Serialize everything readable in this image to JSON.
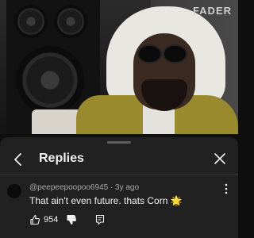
{
  "video": {
    "brand": "FADER"
  },
  "panel": {
    "title": "Replies"
  },
  "comment": {
    "author": "@peepeepoopoo6945",
    "separator": " · ",
    "age": "3y ago",
    "text": "That ain't even future. thats Corn 🌟",
    "likes": "954"
  },
  "icons": {
    "back": "chevron-left-icon",
    "close": "close-icon",
    "more": "more-vert-icon",
    "like": "thumbs-up-icon",
    "dislike": "thumbs-down-icon",
    "reply": "reply-icon"
  },
  "colors": {
    "panel_bg": "#212121",
    "text_primary": "#f1f1f1",
    "text_secondary": "#aaaaaa"
  }
}
